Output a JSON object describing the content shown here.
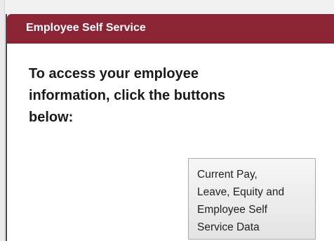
{
  "panel": {
    "title": "Employee Self Service"
  },
  "intro": {
    "line1": "To access your employee",
    "line2": "information, click the buttons",
    "line3": "below:"
  },
  "buttons": [
    {
      "lines": [
        "Current Pay,",
        "Leave, Equity and",
        "Employee Self",
        "Service Data"
      ]
    }
  ],
  "colors": {
    "header_background": "#8b2535",
    "header_text": "#ffffff",
    "body_text": "#1a1a1a"
  }
}
